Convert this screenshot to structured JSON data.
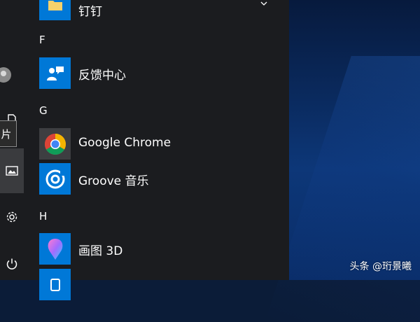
{
  "start_menu": {
    "tooltip_text": "片",
    "rail": {
      "icons": [
        "user-avatar-icon",
        "pictures-icon",
        "settings-gear-icon",
        "power-icon"
      ]
    },
    "groups": [
      {
        "letter": "",
        "apps": [
          {
            "name": "钉钉",
            "icon": "folder-icon"
          }
        ]
      },
      {
        "letter": "F",
        "apps": [
          {
            "name": "反馈中心",
            "icon": "feedback-hub-icon"
          }
        ]
      },
      {
        "letter": "G",
        "apps": [
          {
            "name": "Google Chrome",
            "icon": "chrome-icon"
          },
          {
            "name": "Groove 音乐",
            "icon": "groove-music-icon"
          }
        ]
      },
      {
        "letter": "H",
        "apps": [
          {
            "name": "画图 3D",
            "icon": "paint-3d-icon"
          },
          {
            "name": "",
            "icon": "partial-app-icon"
          }
        ]
      }
    ]
  },
  "watermark": {
    "text": "头条 @珩景曦"
  },
  "colors": {
    "menu_bg": "#1b1c1f",
    "tile_blue": "#0078d7",
    "desktop_blue": "#0a2d68"
  }
}
